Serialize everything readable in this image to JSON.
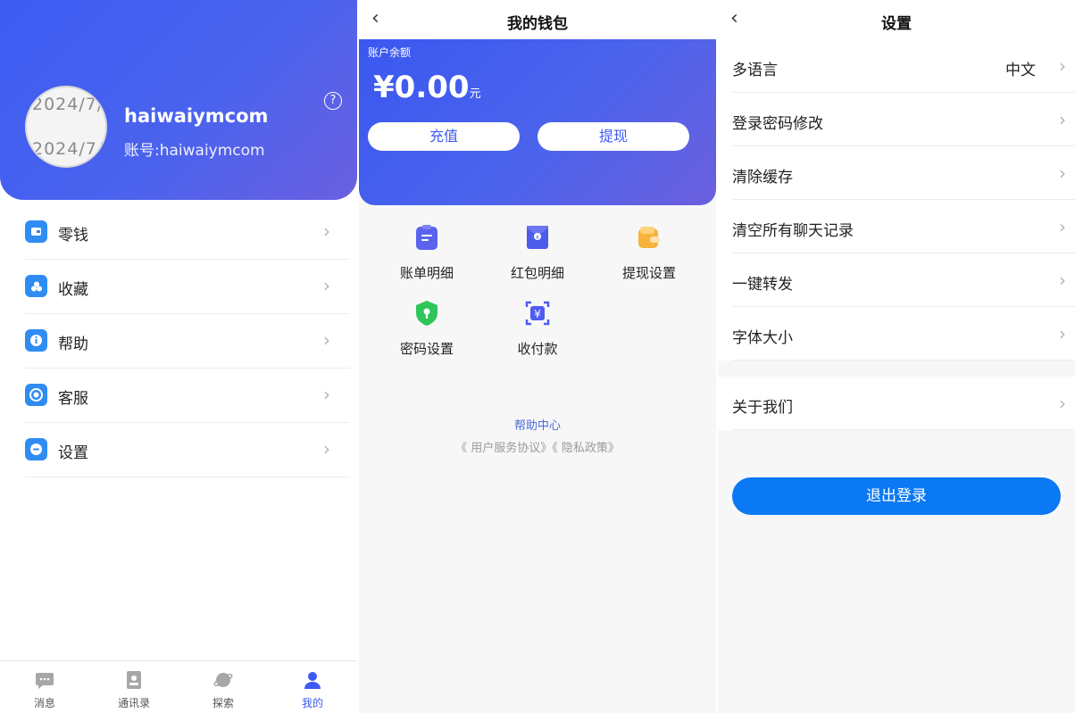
{
  "profile": {
    "avatar_watermark": "2024/7/",
    "username": "haiwaiymcom",
    "account": "账号:haiwaiymcom",
    "help_icon": "question-circle-icon",
    "menu": [
      {
        "label": "零钱",
        "icon": "wallet-icon"
      },
      {
        "label": "收藏",
        "icon": "favorites-icon"
      },
      {
        "label": "帮助",
        "icon": "info-icon"
      },
      {
        "label": "客服",
        "icon": "headset-icon"
      },
      {
        "label": "设置",
        "icon": "settings-icon"
      }
    ],
    "tabs": [
      {
        "label": "消息",
        "icon": "chat-icon"
      },
      {
        "label": "通讯录",
        "icon": "contacts-icon"
      },
      {
        "label": "探索",
        "icon": "planet-icon"
      },
      {
        "label": "我的",
        "icon": "person-icon"
      }
    ],
    "active_tab": "我的",
    "colors": {
      "accent": "#3d5af1",
      "menu_icon": "#2f8cf3"
    }
  },
  "wallet": {
    "title": "我的钱包",
    "balance_label": "账户余额",
    "currency": "¥",
    "balance": "0.00",
    "balance_unit": "元",
    "recharge_label": "充值",
    "withdraw_label": "提现",
    "grid": [
      {
        "label": "账单明细",
        "icon": "bill-icon"
      },
      {
        "label": "红包明细",
        "icon": "red-envelope-icon"
      },
      {
        "label": "提现设置",
        "icon": "wallet-icon"
      },
      {
        "label": "密码设置",
        "icon": "shield-icon"
      },
      {
        "label": "收付款",
        "icon": "yuan-scan-icon"
      }
    ],
    "help_center": "帮助中心",
    "user_agreement": "《 用户服务协议》",
    "privacy_policy": "《 隐私政策》"
  },
  "settings": {
    "title": "设置",
    "items": [
      {
        "label": "多语言",
        "value": "中文"
      },
      {
        "label": "登录密码修改"
      },
      {
        "label": "清除缓存"
      },
      {
        "label": "清空所有聊天记录"
      },
      {
        "label": "一键转发"
      },
      {
        "label": "字体大小"
      }
    ],
    "about": "关于我们",
    "logout": "退出登录",
    "colors": {
      "logout_button": "#0b78f4"
    }
  }
}
